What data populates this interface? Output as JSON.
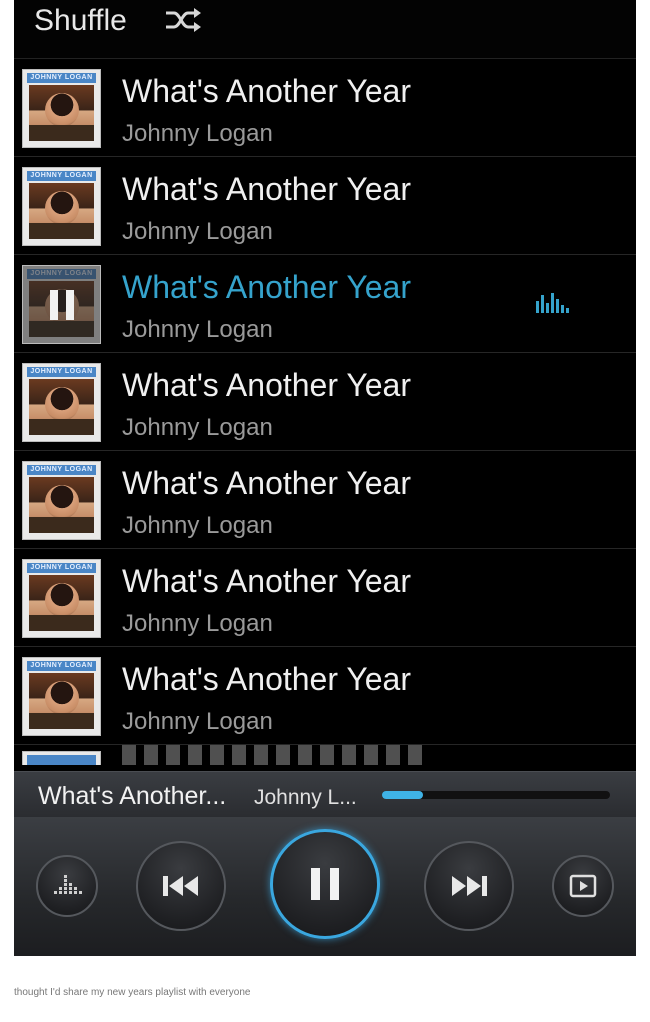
{
  "header": {
    "shuffle_label": "Shuffle",
    "shuffle_icon": "shuffle-icon"
  },
  "tracks": [
    {
      "title": "What's Another Year",
      "artist": "Johnny Logan",
      "art_label": "JOHNNY LOGAN",
      "playing": false
    },
    {
      "title": "What's Another Year",
      "artist": "Johnny Logan",
      "art_label": "JOHNNY LOGAN",
      "playing": false
    },
    {
      "title": "What's Another Year",
      "artist": "Johnny Logan",
      "art_label": "JOHNNY LOGAN",
      "playing": true
    },
    {
      "title": "What's Another Year",
      "artist": "Johnny Logan",
      "art_label": "JOHNNY LOGAN",
      "playing": false
    },
    {
      "title": "What's Another Year",
      "artist": "Johnny Logan",
      "art_label": "JOHNNY LOGAN",
      "playing": false
    },
    {
      "title": "What's Another Year",
      "artist": "Johnny Logan",
      "art_label": "JOHNNY LOGAN",
      "playing": false
    },
    {
      "title": "What's Another Year",
      "artist": "Johnny Logan",
      "art_label": "JOHNNY LOGAN",
      "playing": false
    }
  ],
  "now_playing": {
    "title": "What's Another...",
    "artist": "Johnny L...",
    "progress": 0.18
  },
  "controls": {
    "equalizer": "equalizer-icon",
    "previous": "previous-icon",
    "play_pause": "pause-icon",
    "next": "next-icon",
    "now_playing_screen": "now-playing-icon"
  },
  "colors": {
    "accent": "#35a3cc",
    "progress": "#3fb3e6"
  },
  "caption": "thought I'd share my new years playlist with everyone"
}
